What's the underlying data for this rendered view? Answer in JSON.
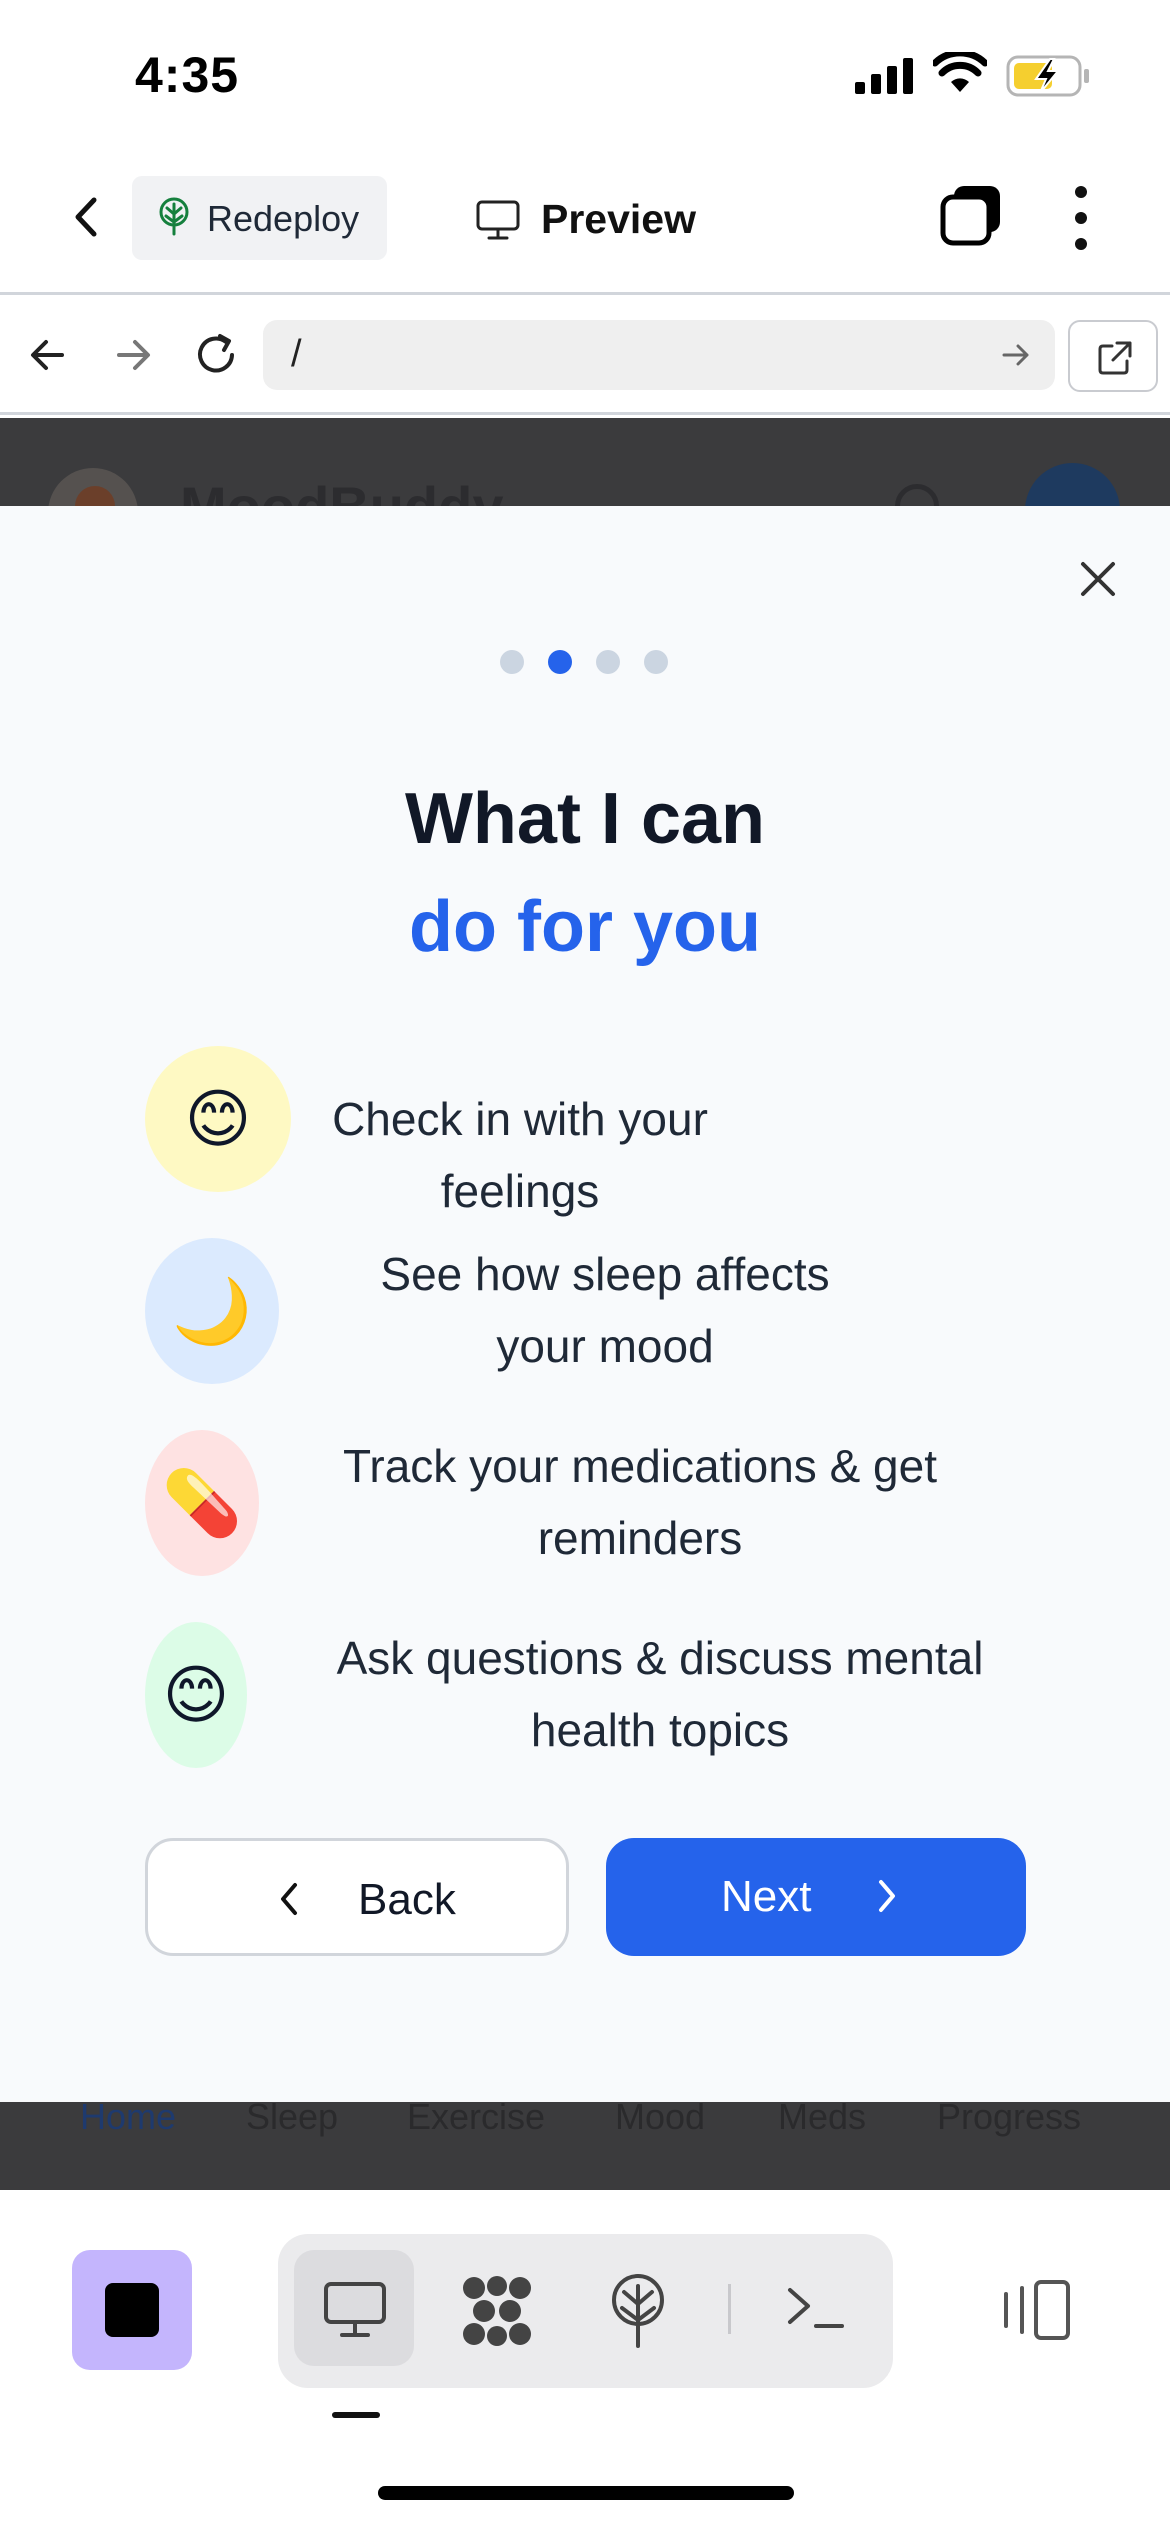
{
  "status_bar": {
    "time": "4:35"
  },
  "app_bar": {
    "redeploy_label": "Redeploy",
    "preview_label": "Preview"
  },
  "browser": {
    "url": "/"
  },
  "site": {
    "brand": "MoodBuddy",
    "tabs": [
      "Home",
      "Sleep",
      "Exercise",
      "Mood",
      "Meds",
      "Progress"
    ],
    "active_tab": "Home"
  },
  "onboarding": {
    "step_count": 4,
    "active_step": 2,
    "title_line1": "What I can",
    "title_line2": "do for you",
    "features": [
      {
        "icon": "smiling-face",
        "emoji": "😊",
        "text": "Check in with your feelings",
        "bg": "#fef9c3"
      },
      {
        "icon": "crescent-moon",
        "emoji": "🌙",
        "text": "See how sleep affects your mood",
        "bg": "#dbeafe"
      },
      {
        "icon": "pill",
        "emoji": "💊",
        "text": "Track your medications & get reminders",
        "bg": "#fee2e2"
      },
      {
        "icon": "smiling-face",
        "emoji": "😊",
        "text": "Ask questions & discuss mental health topics",
        "bg": "#dcfce7"
      }
    ],
    "back_label": "Back",
    "next_label": "Next",
    "accent_color": "#2563eb"
  }
}
